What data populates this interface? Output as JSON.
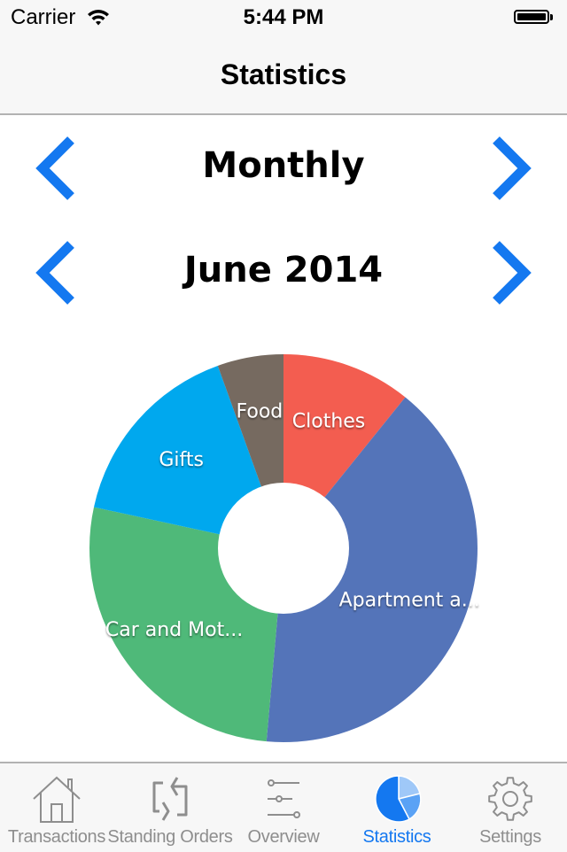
{
  "status_bar": {
    "carrier": "Carrier",
    "time": "5:44 PM",
    "wifi_icon": "wifi-icon",
    "battery_icon": "battery-full-icon"
  },
  "nav": {
    "title": "Statistics"
  },
  "period_selector": {
    "label": "Monthly",
    "prev_icon": "chevron-left-icon",
    "next_icon": "chevron-right-icon"
  },
  "date_selector": {
    "label": "June 2014",
    "prev_icon": "chevron-left-icon",
    "next_icon": "chevron-right-icon"
  },
  "colors": {
    "accent": "#1478f0",
    "tab_inactive": "#8e8e8e"
  },
  "chart_data": {
    "type": "pie",
    "style": "donut",
    "title": "",
    "start": "top",
    "direction": "clockwise",
    "unit": "percent (estimated from slice angles)",
    "slices": [
      {
        "label": "Clothes",
        "full_label": "Clothes",
        "value": 10.8,
        "color": "#f35d50"
      },
      {
        "label": "Apartment a...",
        "full_label": "Apartment a...",
        "value": 40.6,
        "color": "#5474b9"
      },
      {
        "label": "Car and Mot...",
        "full_label": "Car and Mot...",
        "value": 27.0,
        "color": "#4fb979"
      },
      {
        "label": "Gifts",
        "full_label": "Gifts",
        "value": 16.1,
        "color": "#00a8ee"
      },
      {
        "label": "Food",
        "full_label": "Food",
        "value": 5.5,
        "color": "#766a60"
      }
    ]
  },
  "tab_bar": {
    "active_index": 3,
    "tabs": [
      {
        "label": "Transactions",
        "icon": "house-icon"
      },
      {
        "label": "Standing Orders",
        "icon": "repeat-icon"
      },
      {
        "label": "Overview",
        "icon": "sliders-icon"
      },
      {
        "label": "Statistics",
        "icon": "pie-chart-icon"
      },
      {
        "label": "Settings",
        "icon": "gear-icon"
      }
    ]
  }
}
